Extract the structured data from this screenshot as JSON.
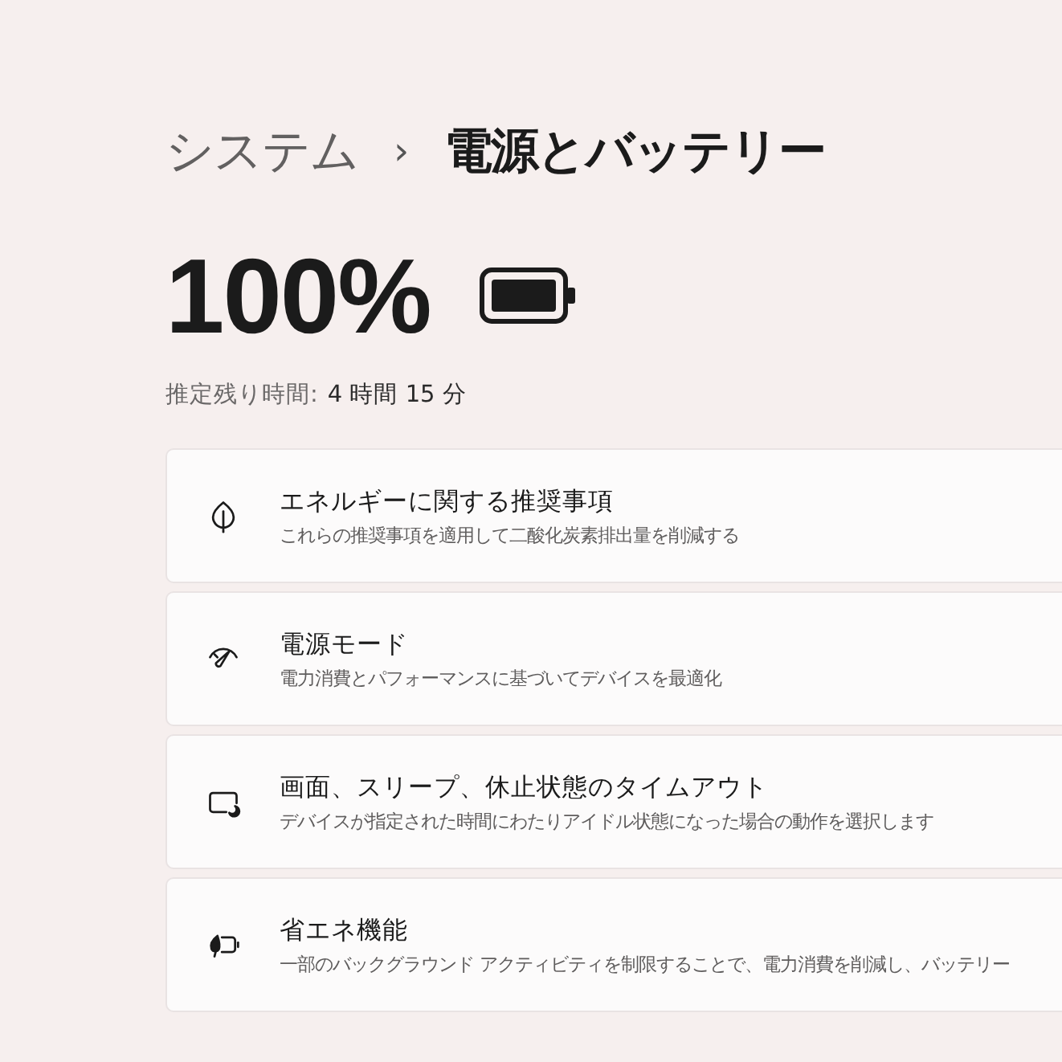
{
  "breadcrumb": {
    "parent": "システム",
    "separator": "›",
    "current": "電源とバッテリー"
  },
  "battery": {
    "percent": "100%",
    "remaining_label": "推定残り時間:",
    "remaining_value": "4 時間 15 分"
  },
  "settings": [
    {
      "kind": "leaf",
      "title": "エネルギーに関する推奨事項",
      "description": "これらの推奨事項を適用して二酸化炭素排出量を削減する"
    },
    {
      "kind": "gauge",
      "title": "電源モード",
      "description": "電力消費とパフォーマンスに基づいてデバイスを最適化"
    },
    {
      "kind": "sleep",
      "title": "画面、スリープ、休止状態のタイムアウト",
      "description": "デバイスが指定された時間にわたりアイドル状態になった場合の動作を選択します"
    },
    {
      "kind": "saver",
      "title": "省エネ機能",
      "description": "一部のバックグラウンド アクティビティを制限することで、電力消費を削減し、バッテリー"
    }
  ]
}
